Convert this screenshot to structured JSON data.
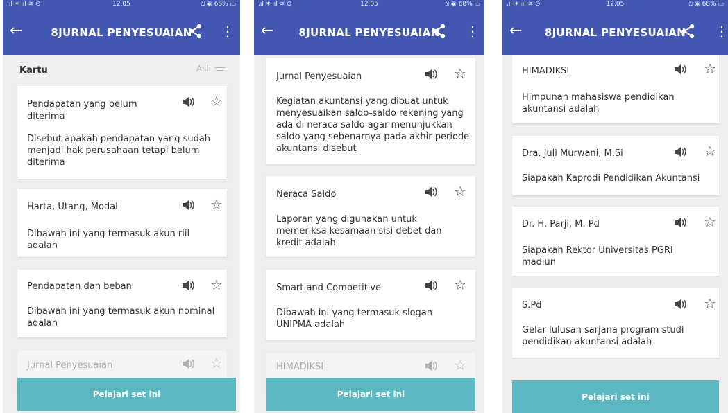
{
  "status": {
    "time": "12.05",
    "signal": ".ıl ✶ ᵢıl ≋ ⊙",
    "right": "⍂ ◉ 68% ▭"
  },
  "header": {
    "title": "8JURNAL PENYESUAIAN"
  },
  "list_header": {
    "label": "Kartu",
    "sort": "Asli"
  },
  "cta": "Pelajari set ini",
  "screens": [
    {
      "cards": [
        {
          "term": "Pendapatan yang belum diterima",
          "def": "Disebut apakah pendapatan yang sudah menjadi hak perusahaan tetapi belum diterima"
        },
        {
          "term": "Harta, Utang, Modal",
          "def": "Dibawah ini yang termasuk akun riil adalah"
        },
        {
          "term": "Pendapatan dan beban",
          "def": "Dibawah ini yang termasuk akun nominal adalah"
        },
        {
          "term": "Jurnal Penyesuaian",
          "def": ""
        }
      ]
    },
    {
      "cards": [
        {
          "term": "Jurnal Penyesuaian",
          "def": "Kegiatan akuntansi yang dibuat untuk menyesuaikan saldo-saldo rekening yang ada di neraca saldo agar menunjukkan saldo yang sebenarnya pada akhir periode akuntansi disebut"
        },
        {
          "term": "Neraca Saldo",
          "def": "Laporan yang digunakan untuk memeriksa kesamaan sisi debet dan kredit adalah"
        },
        {
          "term": "Smart and Competitive",
          "def": "Dibawah ini yang termasuk slogan UNIPMA adalah"
        },
        {
          "term": "HIMADIKSI",
          "def": ""
        }
      ]
    },
    {
      "cards": [
        {
          "term": "HIMADIKSI",
          "def": "Himpunan mahasiswa pendidikan akuntansi adalah"
        },
        {
          "term": "Dra. Juli Murwani, M.Si",
          "def": "Siapakah Kaprodi Pendidikan Akuntansi"
        },
        {
          "term": "Dr. H. Parji, M. Pd",
          "def": "Siapakah Rektor Universitas PGRI madiun"
        },
        {
          "term": "S.Pd",
          "def": "Gelar lulusan sarjana program studi pendidikan akuntansi adalah"
        }
      ]
    }
  ],
  "icons": {
    "back": "arrow-left-icon",
    "share": "share-icon",
    "menu": "more-vert-icon",
    "speaker": "speaker-icon",
    "star": "star-outline-icon",
    "sort": "sort-icon"
  },
  "colors": {
    "appbar": "#4257b2",
    "cta": "#5bb8c2",
    "background": "#efefef"
  }
}
